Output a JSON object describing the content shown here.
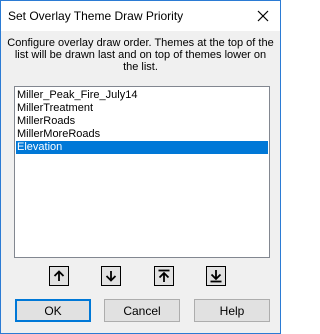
{
  "window": {
    "title": "Set Overlay Theme Draw Priority"
  },
  "description": "Configure overlay draw order. Themes at the top of the list will be drawn last and on top of themes lower on the list.",
  "themes": {
    "items": [
      "Miller_Peak_Fire_July14",
      "MillerTreatment",
      "MillerRoads",
      "MillerMoreRoads",
      "Elevation"
    ],
    "selected": "Elevation"
  },
  "order_buttons": [
    {
      "icon": "arrow-up-icon"
    },
    {
      "icon": "arrow-down-icon"
    },
    {
      "icon": "arrow-to-top-icon"
    },
    {
      "icon": "arrow-to-bottom-icon"
    }
  ],
  "buttons": {
    "ok": "OK",
    "cancel": "Cancel",
    "help": "Help"
  },
  "colors": {
    "accent": "#0078d7",
    "window_border": "#2b7bd4"
  }
}
